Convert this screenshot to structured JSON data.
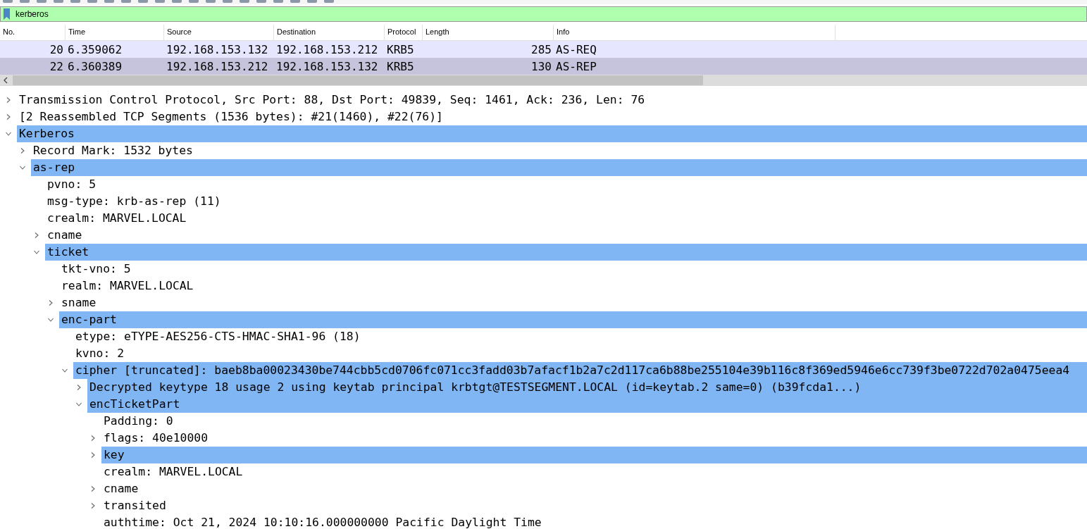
{
  "filter": {
    "value": "kerberos"
  },
  "packet_list": {
    "columns": [
      "No.",
      "Time",
      "Source",
      "Destination",
      "Protocol",
      "Length",
      "Info"
    ],
    "rows": [
      {
        "cells": [
          "20",
          "6.359062",
          "192.168.153.132",
          "192.168.153.212",
          "KRB5",
          "285",
          "AS-REQ"
        ],
        "selected": false
      },
      {
        "cells": [
          "22",
          "6.360389",
          "192.168.153.212",
          "192.168.153.132",
          "KRB5",
          "130",
          "AS-REP"
        ],
        "selected": true
      }
    ]
  },
  "details": [
    {
      "label": "Transmission Control Protocol, Src Port: 88, Dst Port: 49839, Seq: 1461, Ack: 236, Len: 76",
      "expanded": false,
      "selected": false
    },
    {
      "label": "[2 Reassembled TCP Segments (1536 bytes): #21(1460), #22(76)]",
      "expanded": false,
      "selected": false
    },
    {
      "label": "Kerberos",
      "expanded": true,
      "selected": true,
      "children": [
        {
          "label": "Record Mark: 1532 bytes",
          "expanded": false,
          "selected": false
        },
        {
          "label": "as-rep",
          "expanded": true,
          "selected": true,
          "children": [
            {
              "label": "pvno: 5",
              "selected": false
            },
            {
              "label": "msg-type: krb-as-rep (11)",
              "selected": false
            },
            {
              "label": "crealm: MARVEL.LOCAL",
              "selected": false
            },
            {
              "label": "cname",
              "expanded": false,
              "selected": false
            },
            {
              "label": "ticket",
              "expanded": true,
              "selected": true,
              "children": [
                {
                  "label": "tkt-vno: 5",
                  "selected": false
                },
                {
                  "label": "realm: MARVEL.LOCAL",
                  "selected": false
                },
                {
                  "label": "sname",
                  "expanded": false,
                  "selected": false
                },
                {
                  "label": "enc-part",
                  "expanded": true,
                  "selected": true,
                  "children": [
                    {
                      "label": "etype: eTYPE-AES256-CTS-HMAC-SHA1-96 (18)",
                      "selected": false
                    },
                    {
                      "label": "kvno: 2",
                      "selected": false
                    },
                    {
                      "label": "cipher [truncated]: baeb8ba00023430be744cbb5cd0706fc071cc3fadd03b7afacf1b2a7c2d117ca6b88be255104e39b116c8f369ed5946e6cc739f3be0722d702a0475eea4",
                      "expanded": true,
                      "selected": true,
                      "children": [
                        {
                          "label": "Decrypted keytype 18 usage 2 using keytab principal krbtgt@TESTSEGMENT.LOCAL (id=keytab.2 same=0) (b39fcda1...)",
                          "expanded": false,
                          "selected": true
                        },
                        {
                          "label": "encTicketPart",
                          "expanded": true,
                          "selected": true,
                          "children": [
                            {
                              "label": "Padding: 0",
                              "selected": false
                            },
                            {
                              "label": "flags: 40e10000",
                              "expanded": false,
                              "selected": false
                            },
                            {
                              "label": "key",
                              "expanded": false,
                              "selected": true
                            },
                            {
                              "label": "crealm: MARVEL.LOCAL",
                              "selected": false
                            },
                            {
                              "label": "cname",
                              "expanded": false,
                              "selected": false
                            },
                            {
                              "label": "transited",
                              "expanded": false,
                              "selected": false
                            },
                            {
                              "label": "authtime: Oct 21, 2024 10:10:16.000000000 Pacific Daylight Time",
                              "selected": false
                            }
                          ]
                        }
                      ]
                    }
                  ]
                }
              ]
            }
          ]
        }
      ]
    }
  ]
}
